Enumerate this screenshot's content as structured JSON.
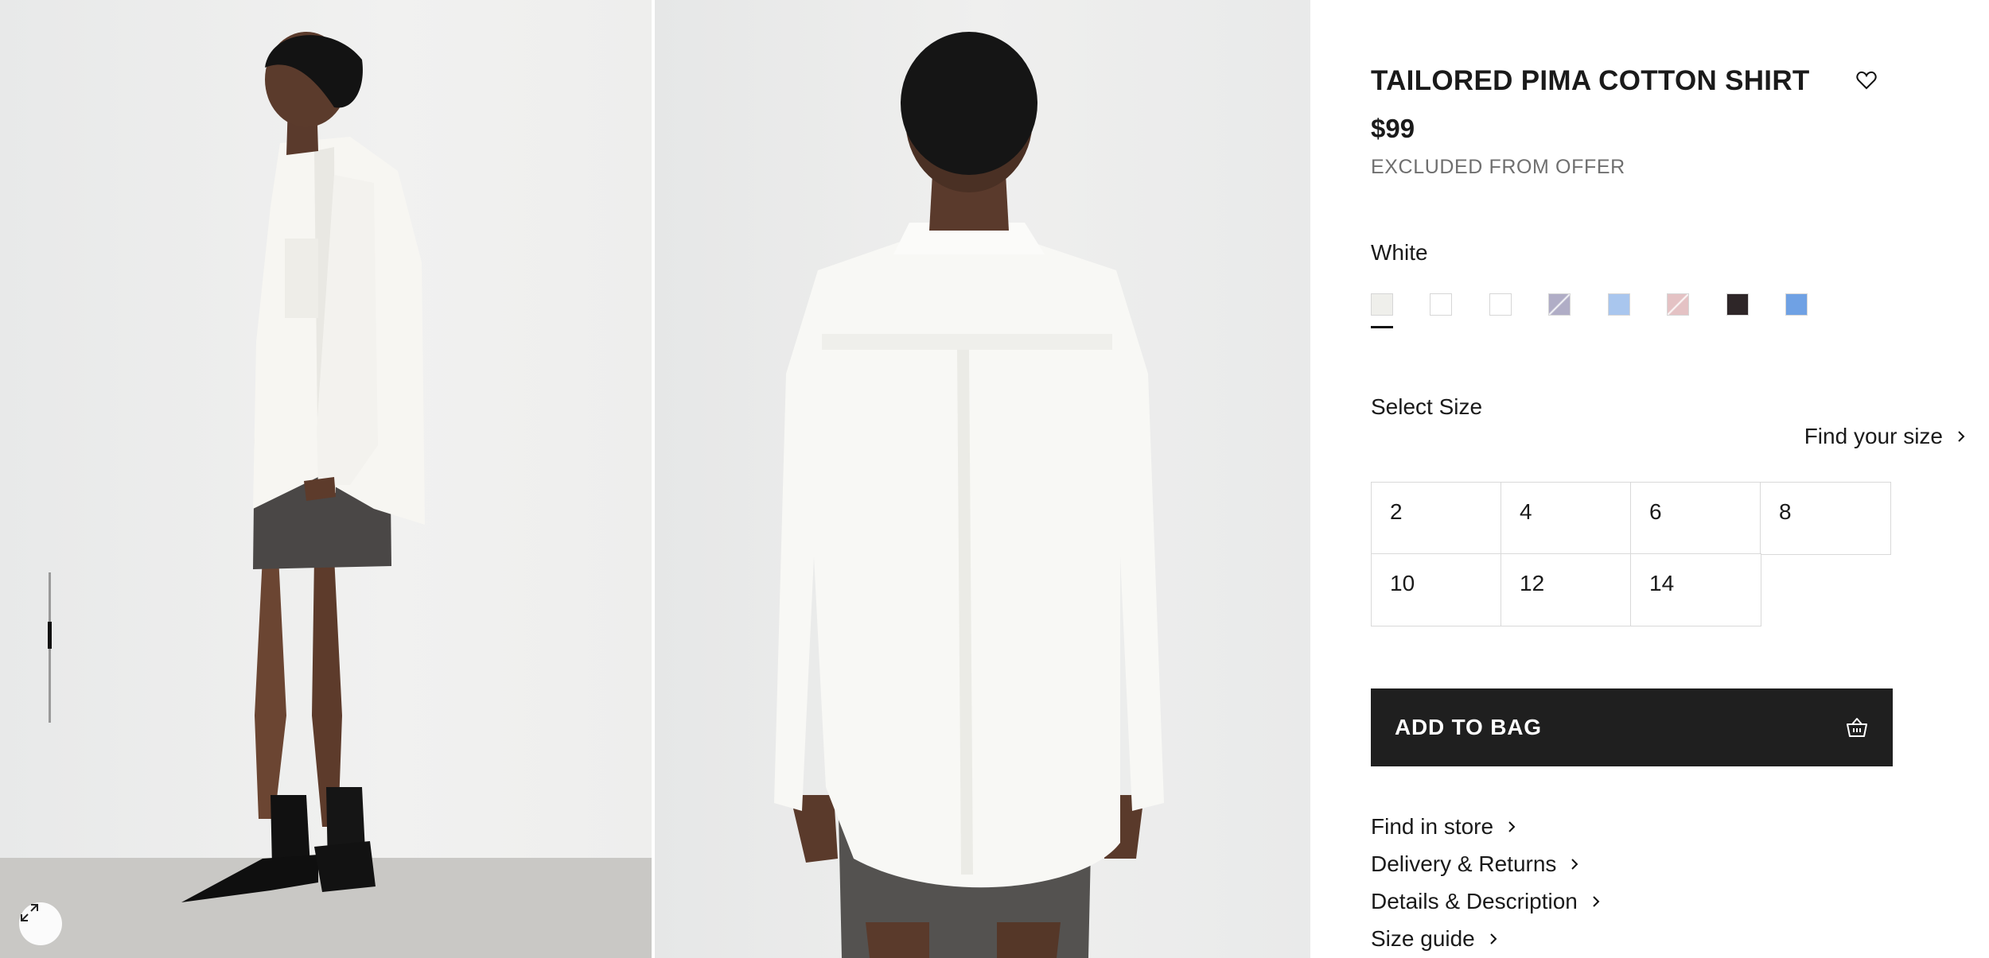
{
  "product": {
    "title": "TAILORED PIMA COTTON SHIRT",
    "price": "$99",
    "offer_note": "EXCLUDED FROM OFFER"
  },
  "gallery": {
    "images": [
      "product-side-view",
      "product-back-view"
    ],
    "scroll_position": 0.4,
    "expand_icon": "expand-icon"
  },
  "color": {
    "selected": "White",
    "swatches": [
      {
        "color": "#efefeb",
        "selected": true
      },
      {
        "color": "#ffffff"
      },
      {
        "color": "#ffffff"
      },
      {
        "color": "#b0adc6",
        "pattern": "stripe"
      },
      {
        "color": "#a9c6ee"
      },
      {
        "color": "#e4c2c4",
        "pattern": "stripe"
      },
      {
        "color": "#2e2628"
      },
      {
        "color": "#6fa1e4"
      }
    ]
  },
  "size": {
    "label": "Select Size",
    "find_your_size": "Find your size",
    "options": [
      "2",
      "4",
      "6",
      "8",
      "10",
      "12",
      "14"
    ]
  },
  "cart": {
    "add_to_bag": "ADD TO BAG",
    "icon": "shopping-basket-icon"
  },
  "links": [
    {
      "label": "Find in store"
    },
    {
      "label": "Delivery & Returns"
    },
    {
      "label": "Details & Description"
    },
    {
      "label": "Size guide"
    }
  ],
  "icons": {
    "wishlist": "heart-icon",
    "chevron": "chevron-right-icon"
  }
}
